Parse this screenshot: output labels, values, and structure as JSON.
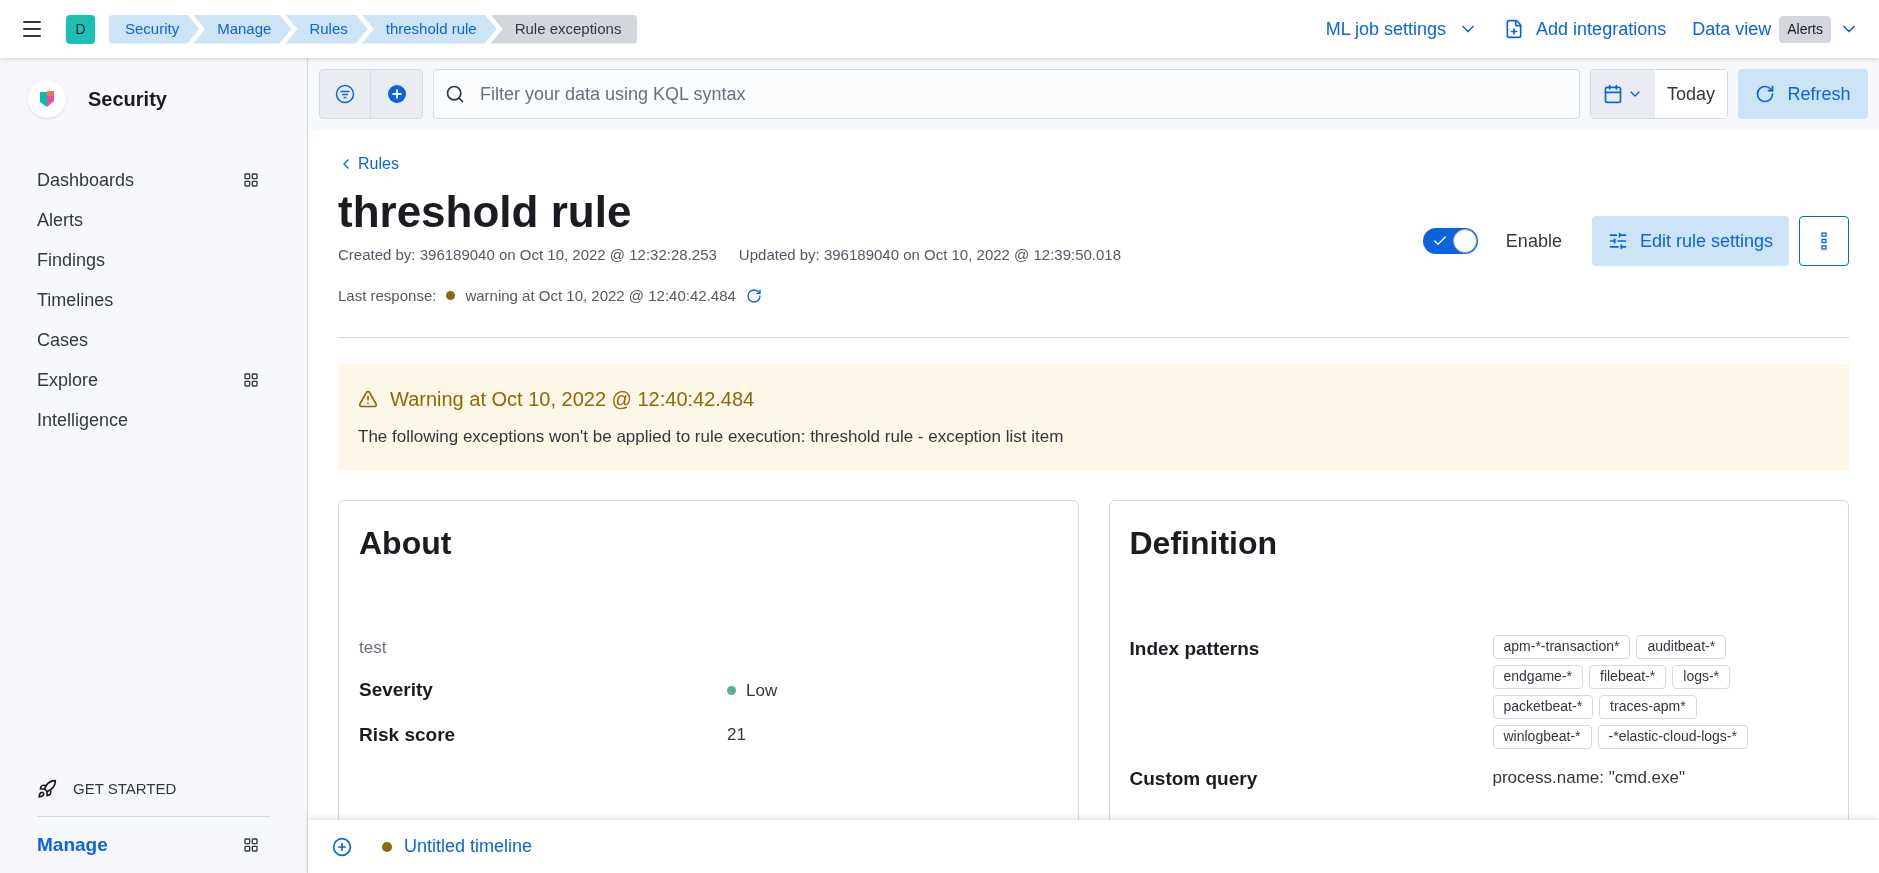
{
  "header": {
    "avatar": "D",
    "breadcrumbs": [
      {
        "label": "Security",
        "selected": false
      },
      {
        "label": "Manage",
        "selected": false
      },
      {
        "label": "Rules",
        "selected": false
      },
      {
        "label": "threshold rule",
        "selected": false
      },
      {
        "label": "Rule exceptions",
        "selected": true
      }
    ],
    "ml_job_settings": "ML job settings",
    "add_integrations": "Add integrations",
    "data_view": "Data view",
    "data_view_badge": "Alerts"
  },
  "sidebar": {
    "title": "Security",
    "items": [
      {
        "label": "Dashboards",
        "has_grid": true
      },
      {
        "label": "Alerts",
        "has_grid": false
      },
      {
        "label": "Findings",
        "has_grid": false
      },
      {
        "label": "Timelines",
        "has_grid": false
      },
      {
        "label": "Cases",
        "has_grid": false
      },
      {
        "label": "Explore",
        "has_grid": true
      },
      {
        "label": "Intelligence",
        "has_grid": false
      }
    ],
    "get_started": "GET STARTED",
    "manage": "Manage"
  },
  "filter_bar": {
    "placeholder": "Filter your data using KQL syntax",
    "date": "Today",
    "refresh": "Refresh"
  },
  "rule": {
    "back_link": "Rules",
    "title": "threshold rule",
    "created": "Created by: 396189040 on Oct 10, 2022 @ 12:32:28.253",
    "updated": "Updated by: 396189040 on Oct 10, 2022 @ 12:39:50.018",
    "last_response_label": "Last response:",
    "last_response": "warning at Oct 10, 2022 @ 12:40:42.484",
    "enabled": true,
    "enable_label": "Enable",
    "edit_button": "Edit rule settings"
  },
  "warning": {
    "title": "Warning at Oct 10, 2022 @ 12:40:42.484",
    "message": "The following exceptions won't be applied to rule execution: threshold rule - exception list item"
  },
  "about": {
    "title": "About",
    "description": "test",
    "fields": [
      {
        "label": "Severity",
        "value": "Low",
        "color": "#54b399"
      },
      {
        "label": "Risk score",
        "value": "21"
      }
    ]
  },
  "definition": {
    "title": "Definition",
    "index_patterns_label": "Index patterns",
    "index_patterns": [
      "apm-*-transaction*",
      "auditbeat-*",
      "endgame-*",
      "filebeat-*",
      "logs-*",
      "packetbeat-*",
      "traces-apm*",
      "winlogbeat-*",
      "-*elastic-cloud-logs-*"
    ],
    "custom_query_label": "Custom query",
    "custom_query": "process.name: \"cmd.exe\""
  },
  "timeline": {
    "title": "Untitled timeline"
  }
}
